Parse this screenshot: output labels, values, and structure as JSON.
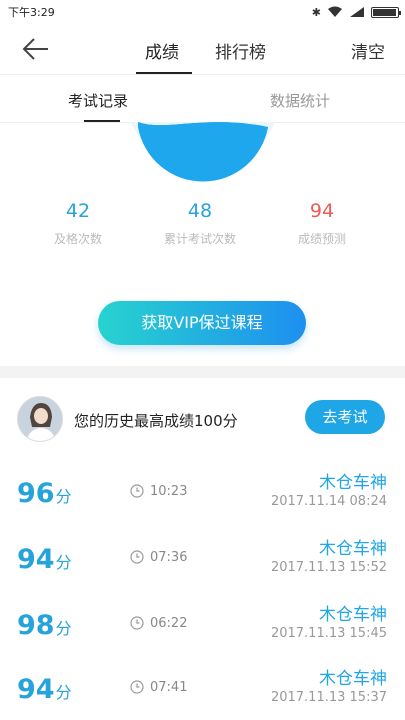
{
  "status": {
    "time": "下午3:29",
    "bt": "✱",
    "battery_level": 0.9
  },
  "nav": {
    "tab_active": "成绩",
    "tab_inactive": "排行榜",
    "right": "清空"
  },
  "subtabs": {
    "active": "考试记录",
    "inactive": "数据统计"
  },
  "stats": [
    {
      "value": "42",
      "label": "及格次数",
      "color": "#27a3dc"
    },
    {
      "value": "48",
      "label": "累计考试次数",
      "color": "#27a3dc"
    },
    {
      "value": "94",
      "label": "成绩预测",
      "color": "#ee5a55"
    }
  ],
  "vip_button": "获取VIP保过课程",
  "best": {
    "text": "您的历史最高成绩100分",
    "button": "去考试"
  },
  "records": [
    {
      "score": "96",
      "unit": "分",
      "duration": "10:23",
      "name": "木仓车神",
      "date": "2017.11.14  08:24"
    },
    {
      "score": "94",
      "unit": "分",
      "duration": "07:36",
      "name": "木仓车神",
      "date": "2017.11.13  15:52"
    },
    {
      "score": "98",
      "unit": "分",
      "duration": "06:22",
      "name": "木仓车神",
      "date": "2017.11.13  15:45"
    },
    {
      "score": "94",
      "unit": "分",
      "duration": "07:41",
      "name": "木仓车神",
      "date": "2017.11.13  15:37"
    }
  ]
}
